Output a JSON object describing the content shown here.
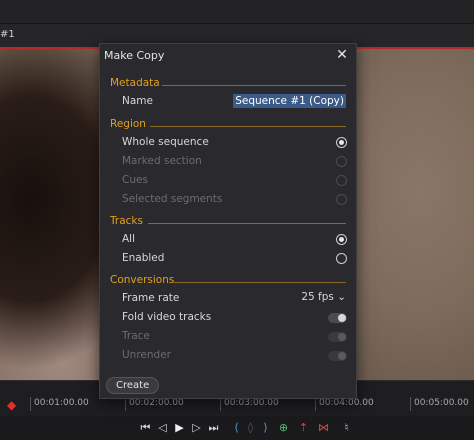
{
  "window": {
    "sequence_tab": "#1"
  },
  "dialog": {
    "title": "Make Copy",
    "close_glyph": "✕",
    "metadata": {
      "title": "Metadata",
      "name_label": "Name",
      "name_value": "Sequence #1 (Copy)"
    },
    "region": {
      "title": "Region",
      "options": [
        {
          "label": "Whole sequence",
          "checked": true,
          "enabled": true
        },
        {
          "label": "Marked section",
          "checked": false,
          "enabled": false
        },
        {
          "label": "Cues",
          "checked": false,
          "enabled": false
        },
        {
          "label": "Selected segments",
          "checked": false,
          "enabled": false
        }
      ]
    },
    "tracks": {
      "title": "Tracks",
      "options": [
        {
          "label": "All",
          "checked": true,
          "enabled": true
        },
        {
          "label": "Enabled",
          "checked": false,
          "enabled": true
        }
      ]
    },
    "conversions": {
      "title": "Conversions",
      "frame_rate_label": "Frame rate",
      "frame_rate_value": "25 fps",
      "fold_label": "Fold video tracks",
      "trace_label": "Trace",
      "unrender_label": "Unrender"
    },
    "create_label": "Create"
  },
  "timeline": {
    "ticks": [
      "00:01:00.00",
      "00:02:00.00",
      "00:03:00.00",
      "00:04:00.00",
      "00:05:00.00"
    ]
  },
  "transport": {
    "icons": [
      "go-to-start-icon",
      "step-back-icon",
      "play-icon",
      "step-forward-icon",
      "go-to-end-icon",
      "mark-in-icon",
      "mark-clear-icon",
      "mark-out-icon",
      "add-cue-icon",
      "lift-icon",
      "extract-icon",
      "voice-over-icon"
    ]
  },
  "colors": {
    "accent": "#e0a020",
    "selection": "#3b5a87",
    "playhead": "#e0302e"
  }
}
